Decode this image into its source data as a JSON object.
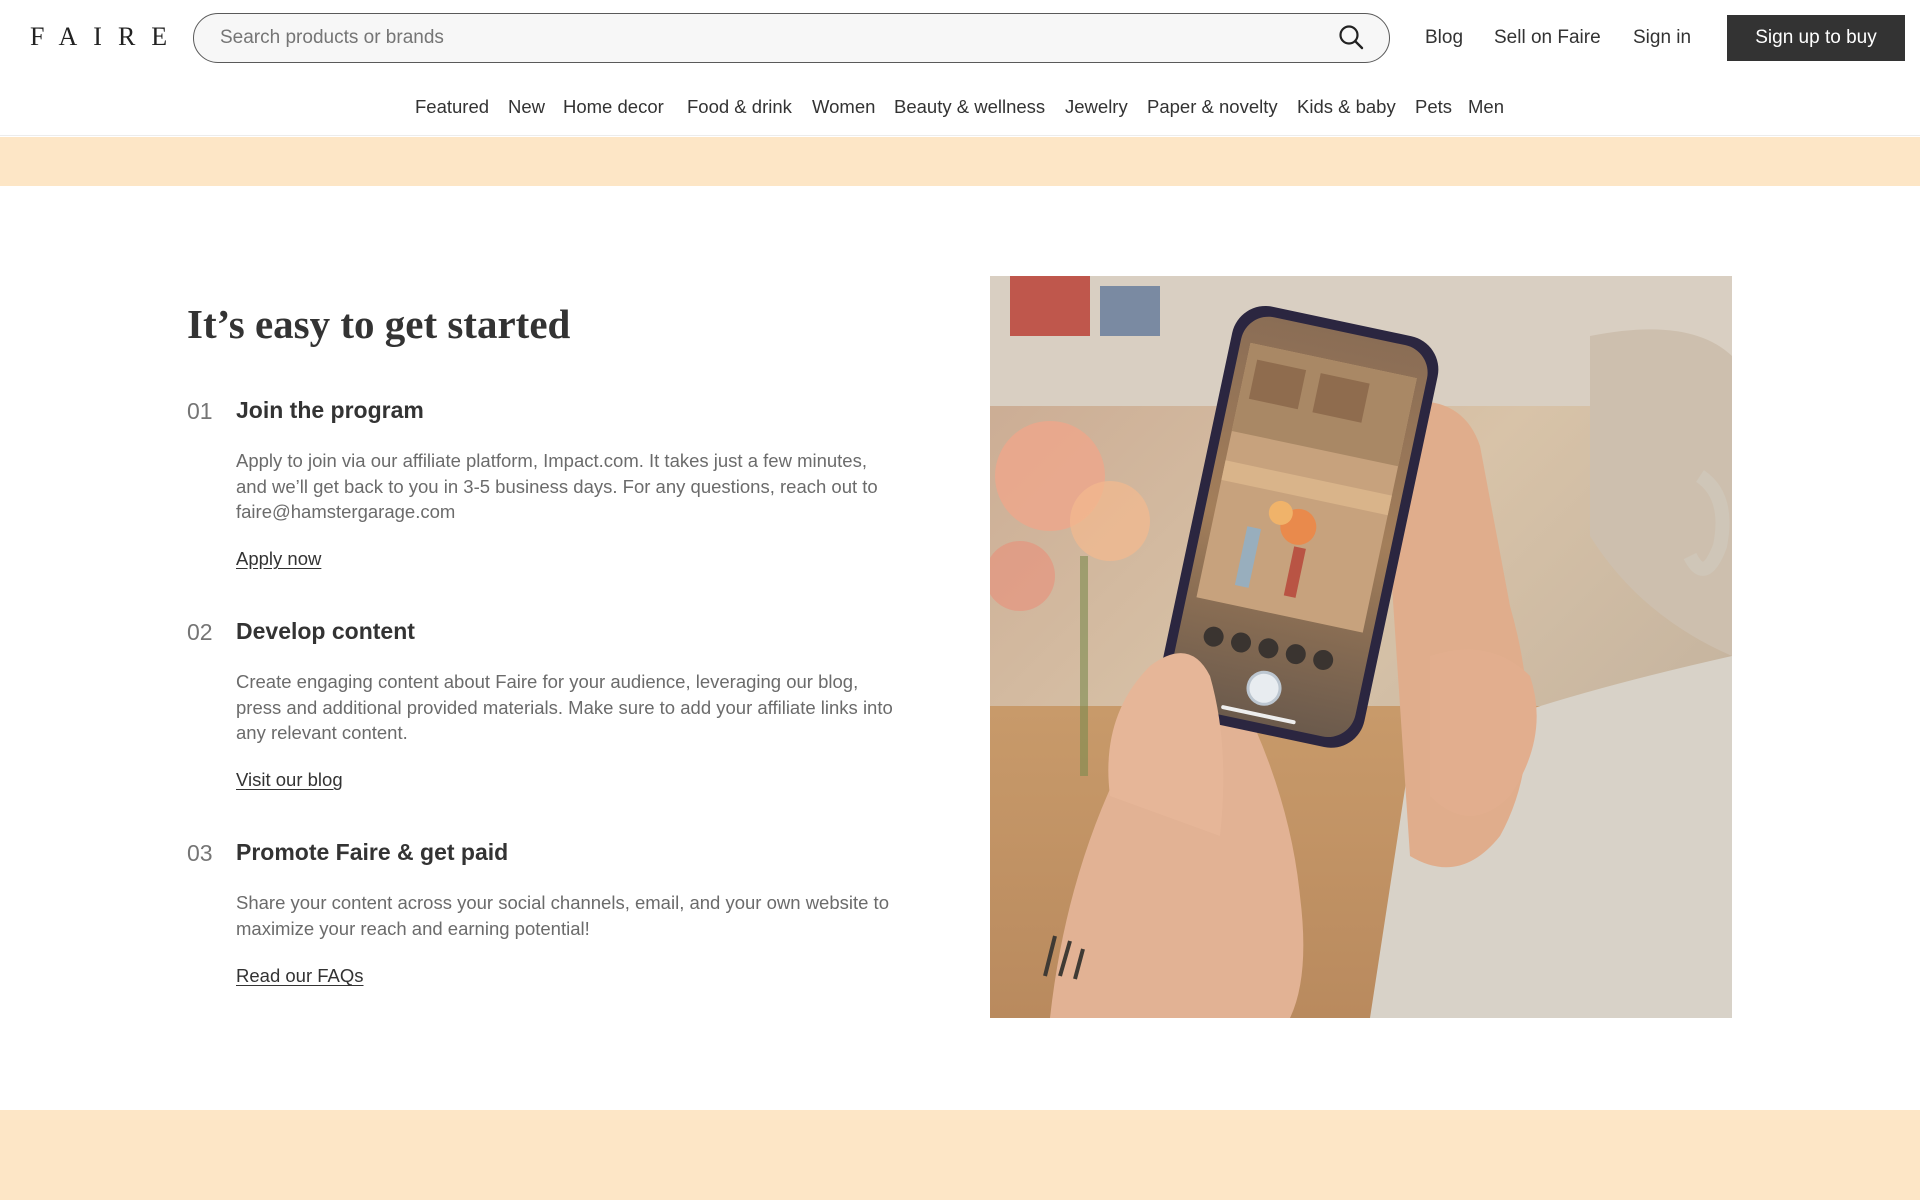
{
  "header": {
    "logo": "FAIRE",
    "search_placeholder": "Search products or brands",
    "links": [
      "Blog",
      "Sell on Faire",
      "Sign in"
    ],
    "signup_label": "Sign up to buy"
  },
  "categories": [
    "Featured",
    "New",
    "Home decor",
    "Food & drink",
    "Women",
    "Beauty & wellness",
    "Jewelry",
    "Paper & novelty",
    "Kids & baby",
    "Pets",
    "Men"
  ],
  "section": {
    "title": "It’s easy to get started",
    "steps": [
      {
        "number": "01",
        "title": "Join the program",
        "lines": [
          "Apply to join via our affiliate platform, Impact.com. It takes just a few minutes,",
          "and we’ll get back to you in 3-5 business days. For any questions, reach out to",
          "faire@hamstergarage.com"
        ],
        "link": "Apply now"
      },
      {
        "number": "02",
        "title": "Develop content",
        "lines": [
          "Create engaging content about Faire for your audience, leveraging our blog,",
          "press and additional provided materials. Make sure to add your affiliate links into",
          "any relevant content."
        ],
        "link": "Visit our blog"
      },
      {
        "number": "03",
        "title": "Promote Faire & get paid",
        "lines": [
          "Share your content across your social channels, email, and your own website to",
          "maximize your reach and earning potential!"
        ],
        "link": "Read our FAQs"
      }
    ]
  },
  "colors": {
    "accent_band": "#fde6c6",
    "primary_button": "#333333",
    "text": "#333333",
    "muted_text": "#6b6b6b"
  },
  "icons": {
    "search": "search-icon"
  }
}
